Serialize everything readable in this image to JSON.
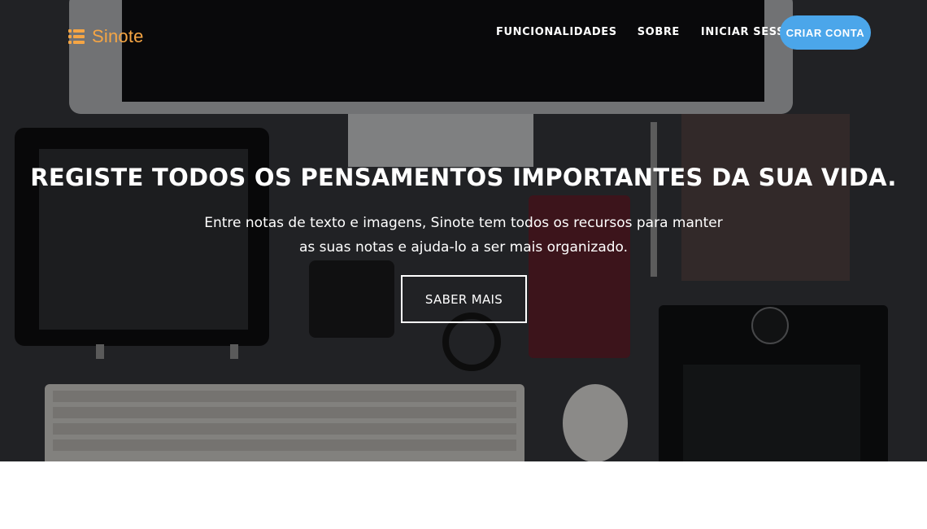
{
  "brand": {
    "name": "Sinote",
    "icon": "list-icon",
    "color": "#f5a544"
  },
  "nav": {
    "links": [
      {
        "label": "FUNCIONALIDADES"
      },
      {
        "label": "SOBRE"
      },
      {
        "label": "INICIAR SESSÃO"
      }
    ],
    "cta_label": "CRIAR CONTA",
    "cta_color": "#4ba6ea"
  },
  "hero": {
    "headline": "REGISTE TODOS OS PENSAMENTOS IMPORTANTES DA SUA VIDA.",
    "subtitle": "Entre notas de texto e imagens, Sinote tem todos os recursos para manter as suas notas e ajuda-lo a ser mais organizado.",
    "button_label": "SABER MAIS"
  }
}
